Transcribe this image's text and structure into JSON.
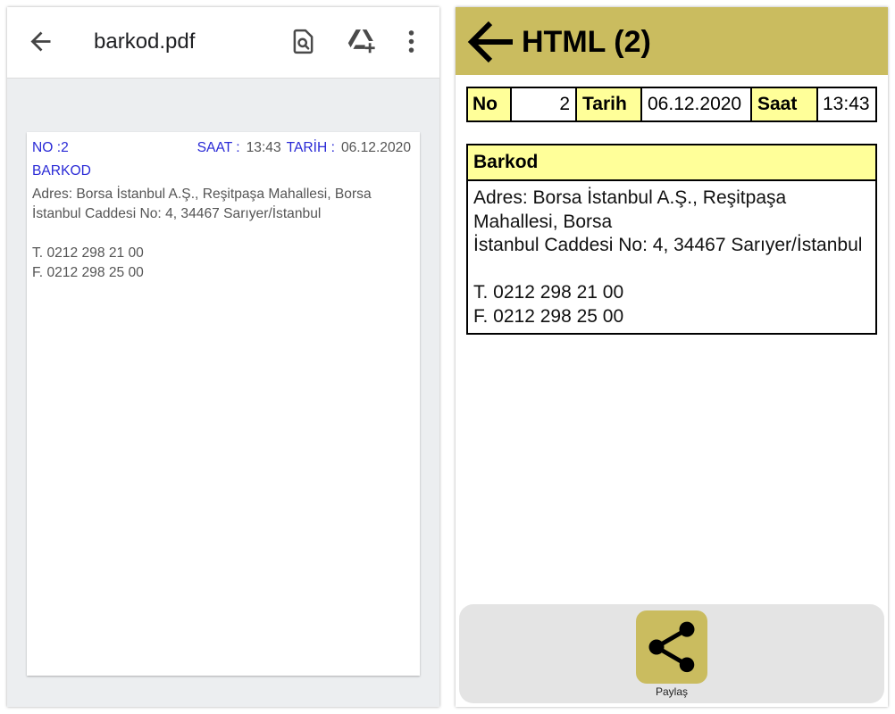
{
  "pdf_viewer": {
    "toolbar": {
      "back_icon": "arrow-back-icon",
      "title": "barkod.pdf",
      "find_icon": "find-in-page-icon",
      "drive_icon": "add-to-drive-icon",
      "more_icon": "more-vertical-icon"
    },
    "page": {
      "no_label": "NO :",
      "no_value": "2",
      "saat_label": "SAAT :",
      "saat_value": "13:43",
      "tarih_label": "TARİH :",
      "tarih_value": "06.12.2020",
      "section_title": "BARKOD",
      "address_lines": [
        "Adres: Borsa İstanbul A.Ş., Reşitpaşa Mahallesi, Borsa",
        "İstanbul Caddesi No: 4, 34467 Sarıyer/İstanbul"
      ],
      "phone": "T. 0212 298 21 00",
      "fax": "F. 0212 298 25 00"
    }
  },
  "html_screen": {
    "header": {
      "back_icon": "arrow-back-icon",
      "title": "HTML (2)"
    },
    "info_table": {
      "no_label": "No",
      "no_value": "2",
      "date_label": "Tarih",
      "date_value": "06.12.2020",
      "time_label": "Saat",
      "time_value": "13:43"
    },
    "barkod_box": {
      "title": "Barkod",
      "address_lines": [
        "Adres: Borsa İstanbul A.Ş., Reşitpaşa Mahallesi, Borsa",
        "İstanbul Caddesi No: 4, 34467 Sarıyer/İstanbul"
      ],
      "phone": "T. 0212 298 21 00",
      "fax": "F. 0212 298 25 00"
    },
    "bottom_bar": {
      "share_icon": "share-icon",
      "share_label": "Paylaş"
    }
  },
  "colors": {
    "app_header": "#cabc5f",
    "table_highlight": "#ffff99",
    "pdf_label_blue": "#2a2ad6",
    "pdf_text": "#555555",
    "viewer_background": "#eceef0",
    "bottom_bar": "#e4e4e4",
    "share_button": "#cabc5f"
  }
}
